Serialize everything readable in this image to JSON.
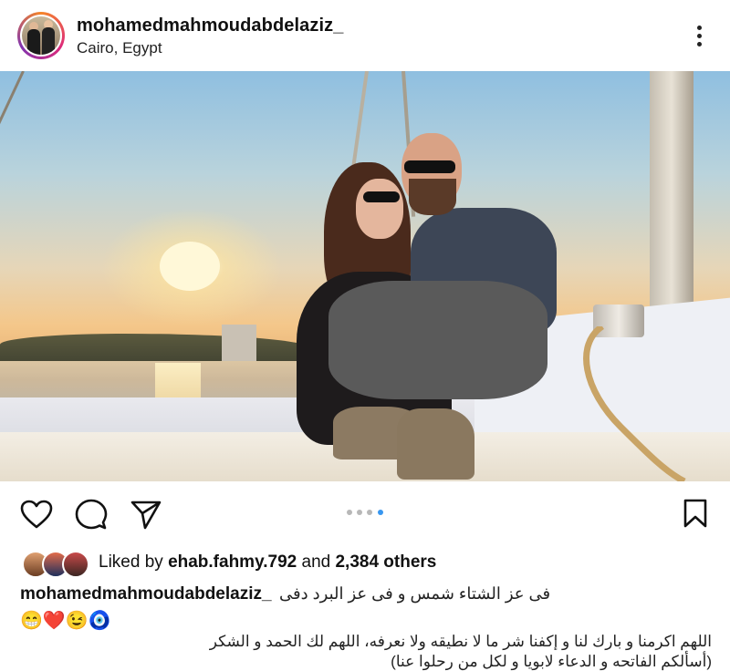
{
  "post": {
    "username": "mohamedmahmoudabdelaziz_",
    "location": "Cairo, Egypt"
  },
  "carousel": {
    "count": 4,
    "active": 4
  },
  "likes": {
    "prefix": "Liked by",
    "user": "ehab.fahmy.792",
    "connector": "and",
    "others": "2,384 others"
  },
  "caption": {
    "username": "mohamedmahmoudabdelaziz_",
    "line1": "فى عز الشتاء شمس و فى عز البرد دفى",
    "emojis": "😁❤️😉🧿",
    "line2": "اللهم اكرمنا و بارك لنا و إكفنا شر ما لا نطيقه ولا نعرفه، اللهم لك الحمد و الشكر",
    "line3": "(أسألكم الفاتحه و الدعاء لابويا و لكل من رحلوا عنا)"
  },
  "icons": {
    "like": "heart-icon",
    "comment": "comment-icon",
    "share": "send-icon",
    "save": "bookmark-icon",
    "more": "more-vertical-icon"
  },
  "colors": {
    "text": "#111111",
    "dot_active": "#3897f0",
    "dot_inactive": "#b8b8b8"
  }
}
